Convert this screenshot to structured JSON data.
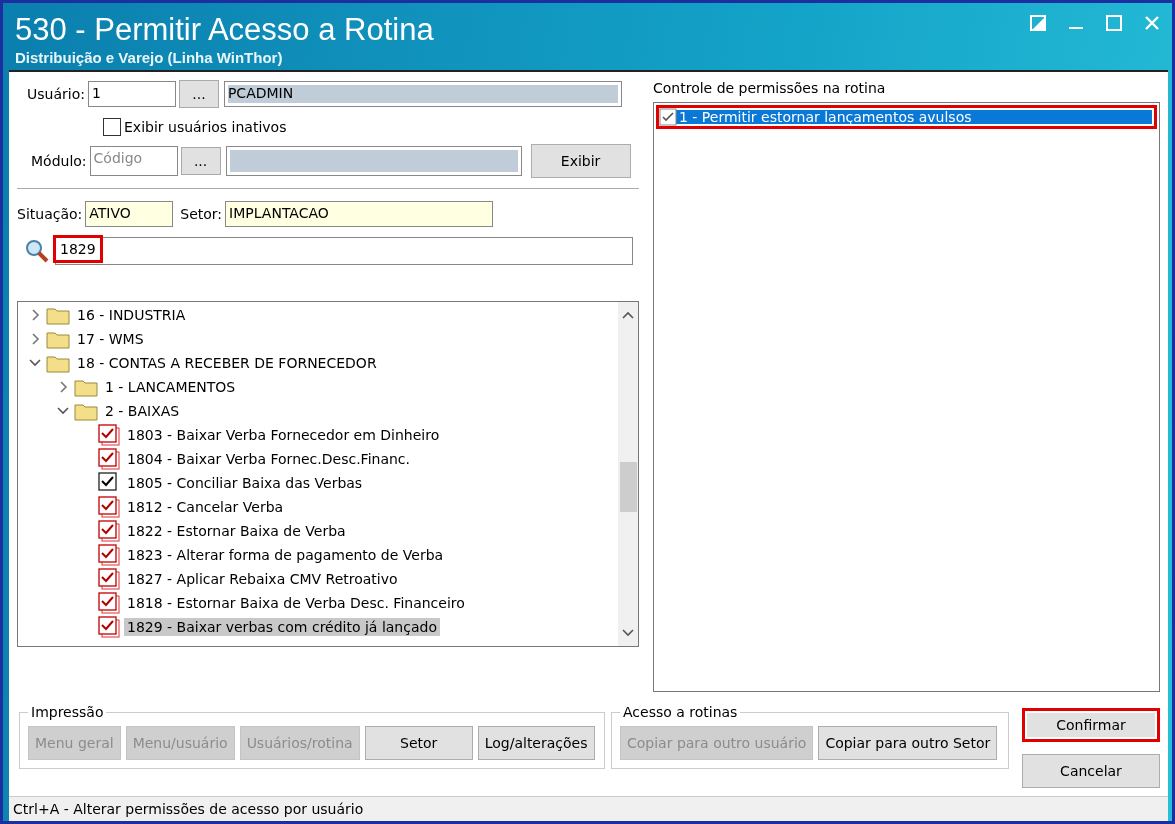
{
  "window": {
    "title": "530 - Permitir Acesso a Rotina",
    "subtitle": "Distribuição e Varejo (Linha WinThor)"
  },
  "user": {
    "label": "Usuário:",
    "code": "1",
    "lookup": "...",
    "name": "PCADMIN"
  },
  "show_inactive": {
    "label": "Exibir usuários inativos",
    "checked": false
  },
  "module": {
    "label": "Módulo:",
    "placeholder": "Código",
    "lookup": "...",
    "button": "Exibir"
  },
  "situation": {
    "label": "Situação:",
    "value": "ATIVO"
  },
  "sector": {
    "label": "Setor:",
    "value": "IMPLANTACAO"
  },
  "search": {
    "value": "1829",
    "highlighted": true
  },
  "tree": [
    {
      "kind": "folder",
      "label": "16 - INDUSTRIA",
      "expanded": false
    },
    {
      "kind": "folder",
      "label": "17 - WMS",
      "expanded": false
    },
    {
      "kind": "folder",
      "label": "18 - CONTAS A RECEBER DE FORNECEDOR",
      "expanded": true,
      "children": [
        {
          "kind": "folder",
          "label": "1 - LANCAMENTOS",
          "expanded": false
        },
        {
          "kind": "folder",
          "label": "2 - BAIXAS",
          "expanded": true,
          "children": [
            {
              "kind": "routine",
              "label": "1803 - Baixar Verba Fornecedor em Dinheiro",
              "checked": true,
              "changed": true,
              "selected": false
            },
            {
              "kind": "routine",
              "label": "1804 - Baixar Verba Fornec.Desc.Financ.",
              "checked": true,
              "changed": true,
              "selected": false
            },
            {
              "kind": "routine",
              "label": "1805 - Conciliar Baixa das Verbas",
              "checked": true,
              "changed": false,
              "selected": false
            },
            {
              "kind": "routine",
              "label": "1812 - Cancelar Verba",
              "checked": true,
              "changed": true,
              "selected": false
            },
            {
              "kind": "routine",
              "label": "1822 - Estornar Baixa de Verba",
              "checked": true,
              "changed": true,
              "selected": false
            },
            {
              "kind": "routine",
              "label": "1823 - Alterar forma de pagamento de Verba",
              "checked": true,
              "changed": true,
              "selected": false
            },
            {
              "kind": "routine",
              "label": "1827 - Aplicar Rebaixa CMV Retroativo",
              "checked": true,
              "changed": true,
              "selected": false
            },
            {
              "kind": "routine",
              "label": "1818 - Estornar Baixa de Verba Desc. Financeiro",
              "checked": true,
              "changed": true,
              "selected": false
            },
            {
              "kind": "routine",
              "label": "1829 - Baixar verbas com crédito já lançado",
              "checked": true,
              "changed": true,
              "selected": true
            }
          ]
        }
      ]
    }
  ],
  "permissions": {
    "title": "Controle de permissões na rotina",
    "items": [
      {
        "label": "1 - Permitir estornar lançamentos avulsos",
        "checked": true,
        "selected": true,
        "highlighted": true
      }
    ]
  },
  "print_group": {
    "title": "Impressão",
    "buttons": [
      {
        "label": "Menu geral",
        "disabled": true
      },
      {
        "label": "Menu/usuário",
        "disabled": true
      },
      {
        "label": "Usuários/rotina",
        "disabled": true
      },
      {
        "label": "Setor",
        "disabled": false
      },
      {
        "label": "Log/alterações",
        "disabled": false
      }
    ]
  },
  "access_group": {
    "title": "Acesso a rotinas",
    "buttons": [
      {
        "label": "Copiar para outro usuário",
        "disabled": true
      },
      {
        "label": "Copiar para outro Setor",
        "disabled": false
      }
    ]
  },
  "actions": [
    {
      "label": "Confirmar",
      "highlighted": true
    },
    {
      "label": "Cancelar",
      "highlighted": false
    }
  ],
  "status_bar": "Ctrl+A - Alterar permissões de acesso por usuário"
}
